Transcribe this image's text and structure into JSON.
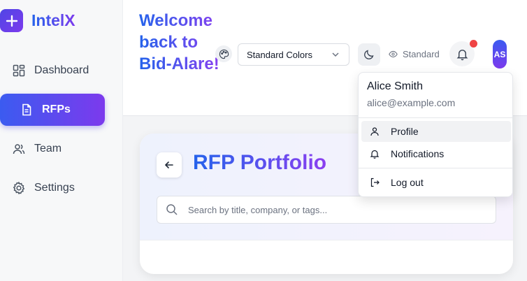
{
  "brand": {
    "name": "IntelX",
    "logo_icon": "plus-icon"
  },
  "sidebar": {
    "items": [
      {
        "label": "Dashboard",
        "icon": "dashboard-icon",
        "active": false
      },
      {
        "label": "RFPs",
        "icon": "document-icon",
        "active": true
      },
      {
        "label": "Team",
        "icon": "users-icon",
        "active": false
      },
      {
        "label": "Settings",
        "icon": "gear-icon",
        "active": false
      }
    ]
  },
  "header": {
    "welcome": "Welcome back to Bid-Alare!",
    "color_select": {
      "value": "Standard Colors",
      "icon": "palette-icon"
    },
    "theme_icon": "moon-icon",
    "mode_label": "Standard",
    "notification_badge": true,
    "avatar_initials": "AS"
  },
  "user_menu": {
    "name": "Alice Smith",
    "email": "alice@example.com",
    "items": [
      {
        "label": "Profile",
        "icon": "user-icon"
      },
      {
        "label": "Notifications",
        "icon": "bell-icon"
      },
      {
        "label": "Log out",
        "icon": "logout-icon"
      }
    ]
  },
  "main": {
    "title": "RFP Portfolio",
    "search_placeholder": "Search by title, company, or tags..."
  },
  "colors": {
    "accent_start": "#2563eb",
    "accent_end": "#7c3aed",
    "badge": "#ef4444"
  }
}
